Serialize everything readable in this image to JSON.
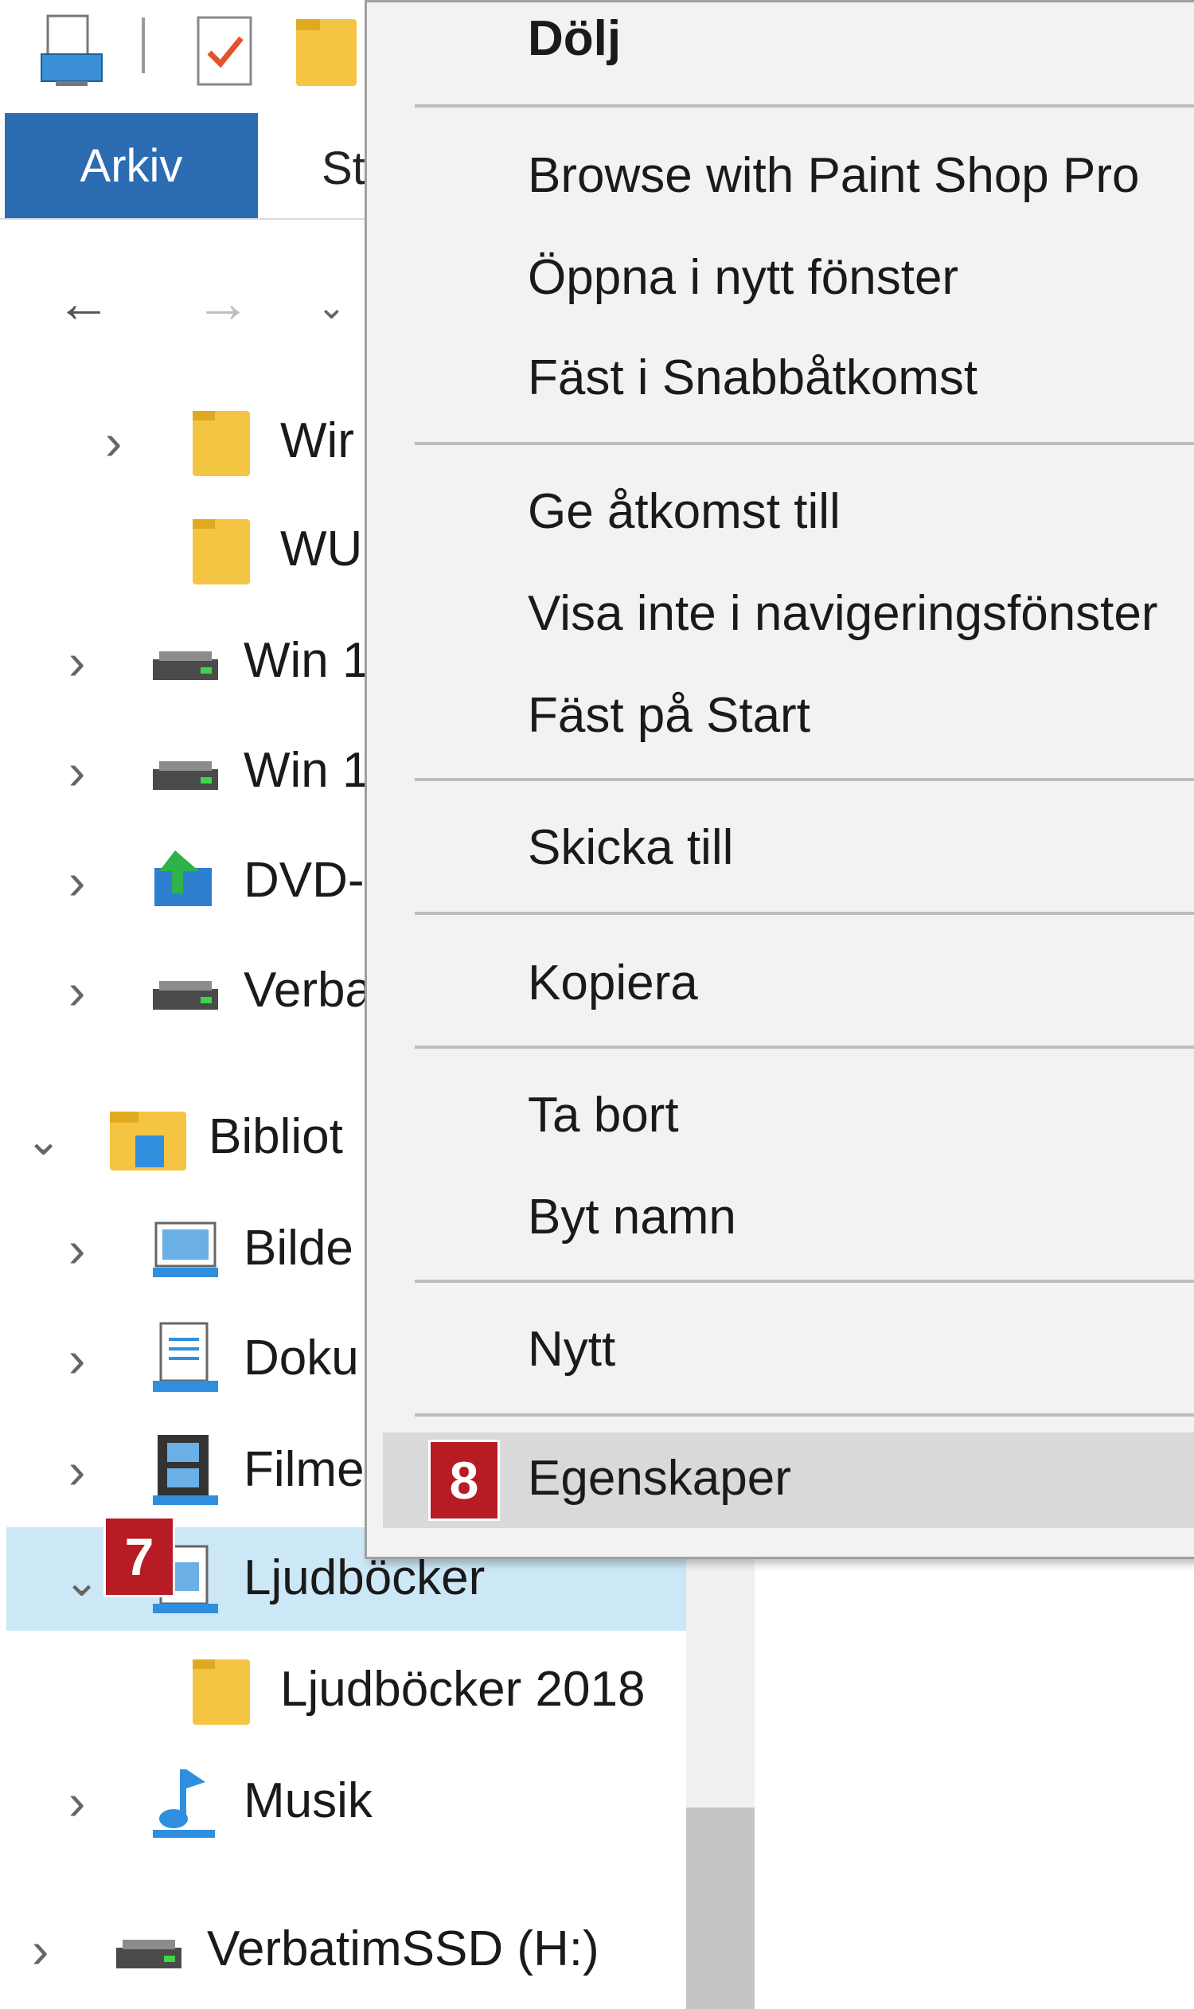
{
  "ribbon": {
    "file_tab": "Arkiv",
    "start_tab": "St"
  },
  "tree": [
    {
      "label": "Wir",
      "icon": "folder-icon",
      "chevron": ">"
    },
    {
      "label": "WU",
      "icon": "folder-icon",
      "chevron": ""
    },
    {
      "label": "Win 1",
      "icon": "drive-icon",
      "chevron": ">"
    },
    {
      "label": "Win 1",
      "icon": "drive-icon",
      "chevron": ">"
    },
    {
      "label": "DVD-",
      "icon": "dvd-drive-icon",
      "chevron": ">"
    },
    {
      "label": "Verba",
      "icon": "drive-icon",
      "chevron": ">"
    },
    {
      "label": "Bibliot",
      "icon": "libraries-icon",
      "chevron": "v"
    },
    {
      "label": "Bilde",
      "icon": "pictures-library-icon",
      "chevron": ">"
    },
    {
      "label": "Doku",
      "icon": "documents-library-icon",
      "chevron": ">"
    },
    {
      "label": "Filme",
      "icon": "videos-library-icon",
      "chevron": ">"
    },
    {
      "label": "Ljudböcker",
      "icon": "library-icon",
      "chevron": "v",
      "selected": true
    },
    {
      "label": "Ljudböcker 2018",
      "icon": "folder-icon",
      "chevron": ""
    },
    {
      "label": "Musik",
      "icon": "music-library-icon",
      "chevron": ">"
    },
    {
      "label": "VerbatimSSD (H:)",
      "icon": "drive-icon",
      "chevron": ">"
    }
  ],
  "context_menu": {
    "items": [
      {
        "label": "Dölj",
        "bold": true
      },
      {
        "label": "Browse with Paint Shop Pro"
      },
      {
        "label": "Öppna i nytt fönster"
      },
      {
        "label": "Fäst i Snabbåtkomst"
      },
      {
        "label": "Ge åtkomst till"
      },
      {
        "label": "Visa inte i navigeringsfönster"
      },
      {
        "label": "Fäst på Start"
      },
      {
        "label": "Skicka till"
      },
      {
        "label": "Kopiera"
      },
      {
        "label": "Ta bort"
      },
      {
        "label": "Byt namn"
      },
      {
        "label": "Nytt"
      },
      {
        "label": "Egenskaper",
        "highlighted": true
      }
    ]
  },
  "callouts": {
    "step7": "7",
    "step8": "8"
  },
  "colors": {
    "accent": "#2b6cb3",
    "selection": "#cce8f6",
    "callout": "#b71c24",
    "menu_bg": "#f2f2f2",
    "menu_highlight": "#d9d9d9"
  }
}
